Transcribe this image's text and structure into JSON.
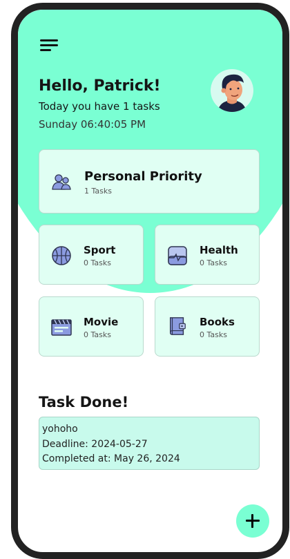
{
  "header": {
    "greeting": "Hello, Patrick!",
    "tasks_summary": "Today you have 1 tasks",
    "datetime": "Sunday 06:40:05 PM",
    "menu_icon": "hamburger-menu-icon",
    "avatar_icon": "user-avatar"
  },
  "categories": [
    {
      "title": "Personal Priority",
      "count": "1 Tasks",
      "icon": "people-icon"
    },
    {
      "title": "Sport",
      "count": "0 Tasks",
      "icon": "basketball-icon"
    },
    {
      "title": "Health",
      "count": "0 Tasks",
      "icon": "heartbeat-icon"
    },
    {
      "title": "Movie",
      "count": "0 Tasks",
      "icon": "clapperboard-icon"
    },
    {
      "title": "Books",
      "count": "0 Tasks",
      "icon": "book-icon"
    }
  ],
  "task_done": {
    "title": "Task Done!",
    "items": [
      {
        "name": "yohoho",
        "deadline": "Deadline: 2024-05-27",
        "completed": "Completed at: May 26, 2024"
      }
    ]
  },
  "fab": {
    "icon": "plus-icon"
  },
  "colors": {
    "accent": "#7affd3",
    "card_bg": "#e0fff3",
    "done_card_bg": "#c8faec",
    "icon_fill": "#8b9be0",
    "icon_stroke": "#2f3552"
  }
}
